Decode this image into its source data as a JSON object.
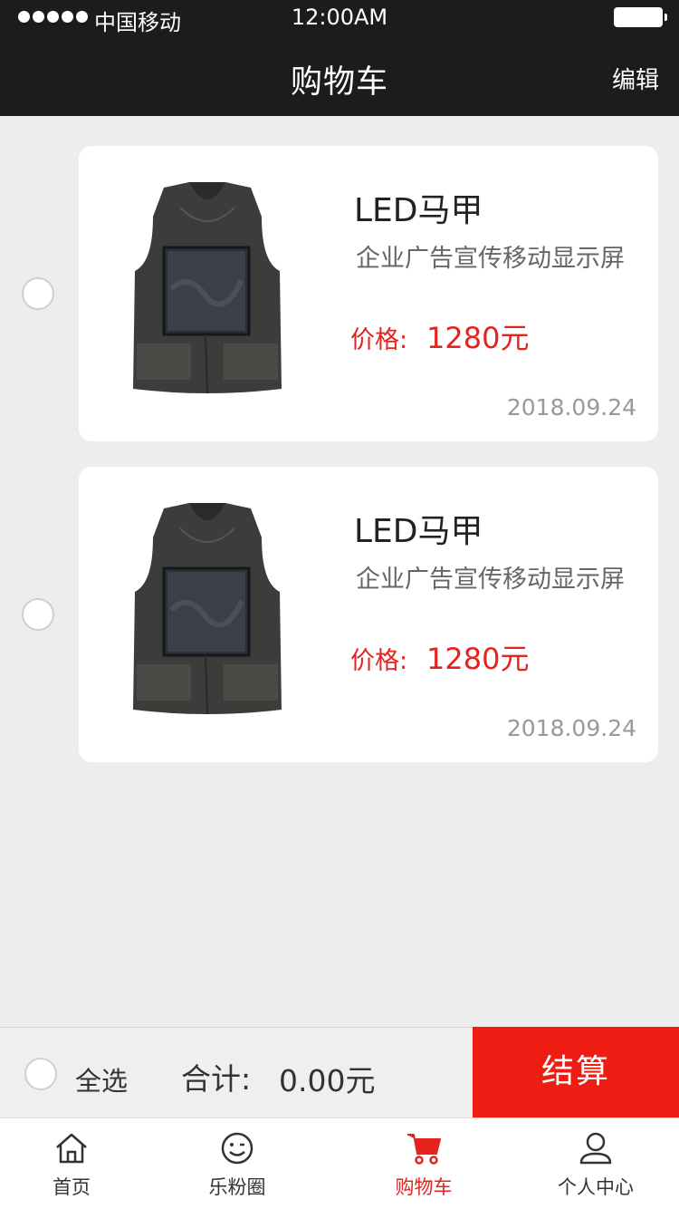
{
  "status_bar": {
    "carrier": "中国移动",
    "time": "12:00AM"
  },
  "header": {
    "title": "购物车",
    "edit_label": "编辑"
  },
  "cart_items": [
    {
      "name": "LED马甲",
      "description": "企业广告宣传移动显示屏",
      "price_label": "价格:",
      "price": "1280元",
      "date": "2018.09.24",
      "selected": false
    },
    {
      "name": "LED马甲",
      "description": "企业广告宣传移动显示屏",
      "price_label": "价格:",
      "price": "1280元",
      "date": "2018.09.24",
      "selected": false
    }
  ],
  "checkout_bar": {
    "select_all_label": "全选",
    "total_label": "合计:",
    "total_value": "0.00元",
    "checkout_label": "结算"
  },
  "tab_bar": {
    "tabs": [
      {
        "label": "首页",
        "icon": "home-icon"
      },
      {
        "label": "乐粉圈",
        "icon": "smiley-icon"
      },
      {
        "label": "购物车",
        "icon": "cart-icon",
        "active": true
      },
      {
        "label": "个人中心",
        "icon": "person-icon"
      }
    ]
  },
  "colors": {
    "header_bg": "#1c1c1c",
    "accent_red": "#ee1c13",
    "price_red": "#e4231f",
    "page_bg": "#ededed"
  }
}
